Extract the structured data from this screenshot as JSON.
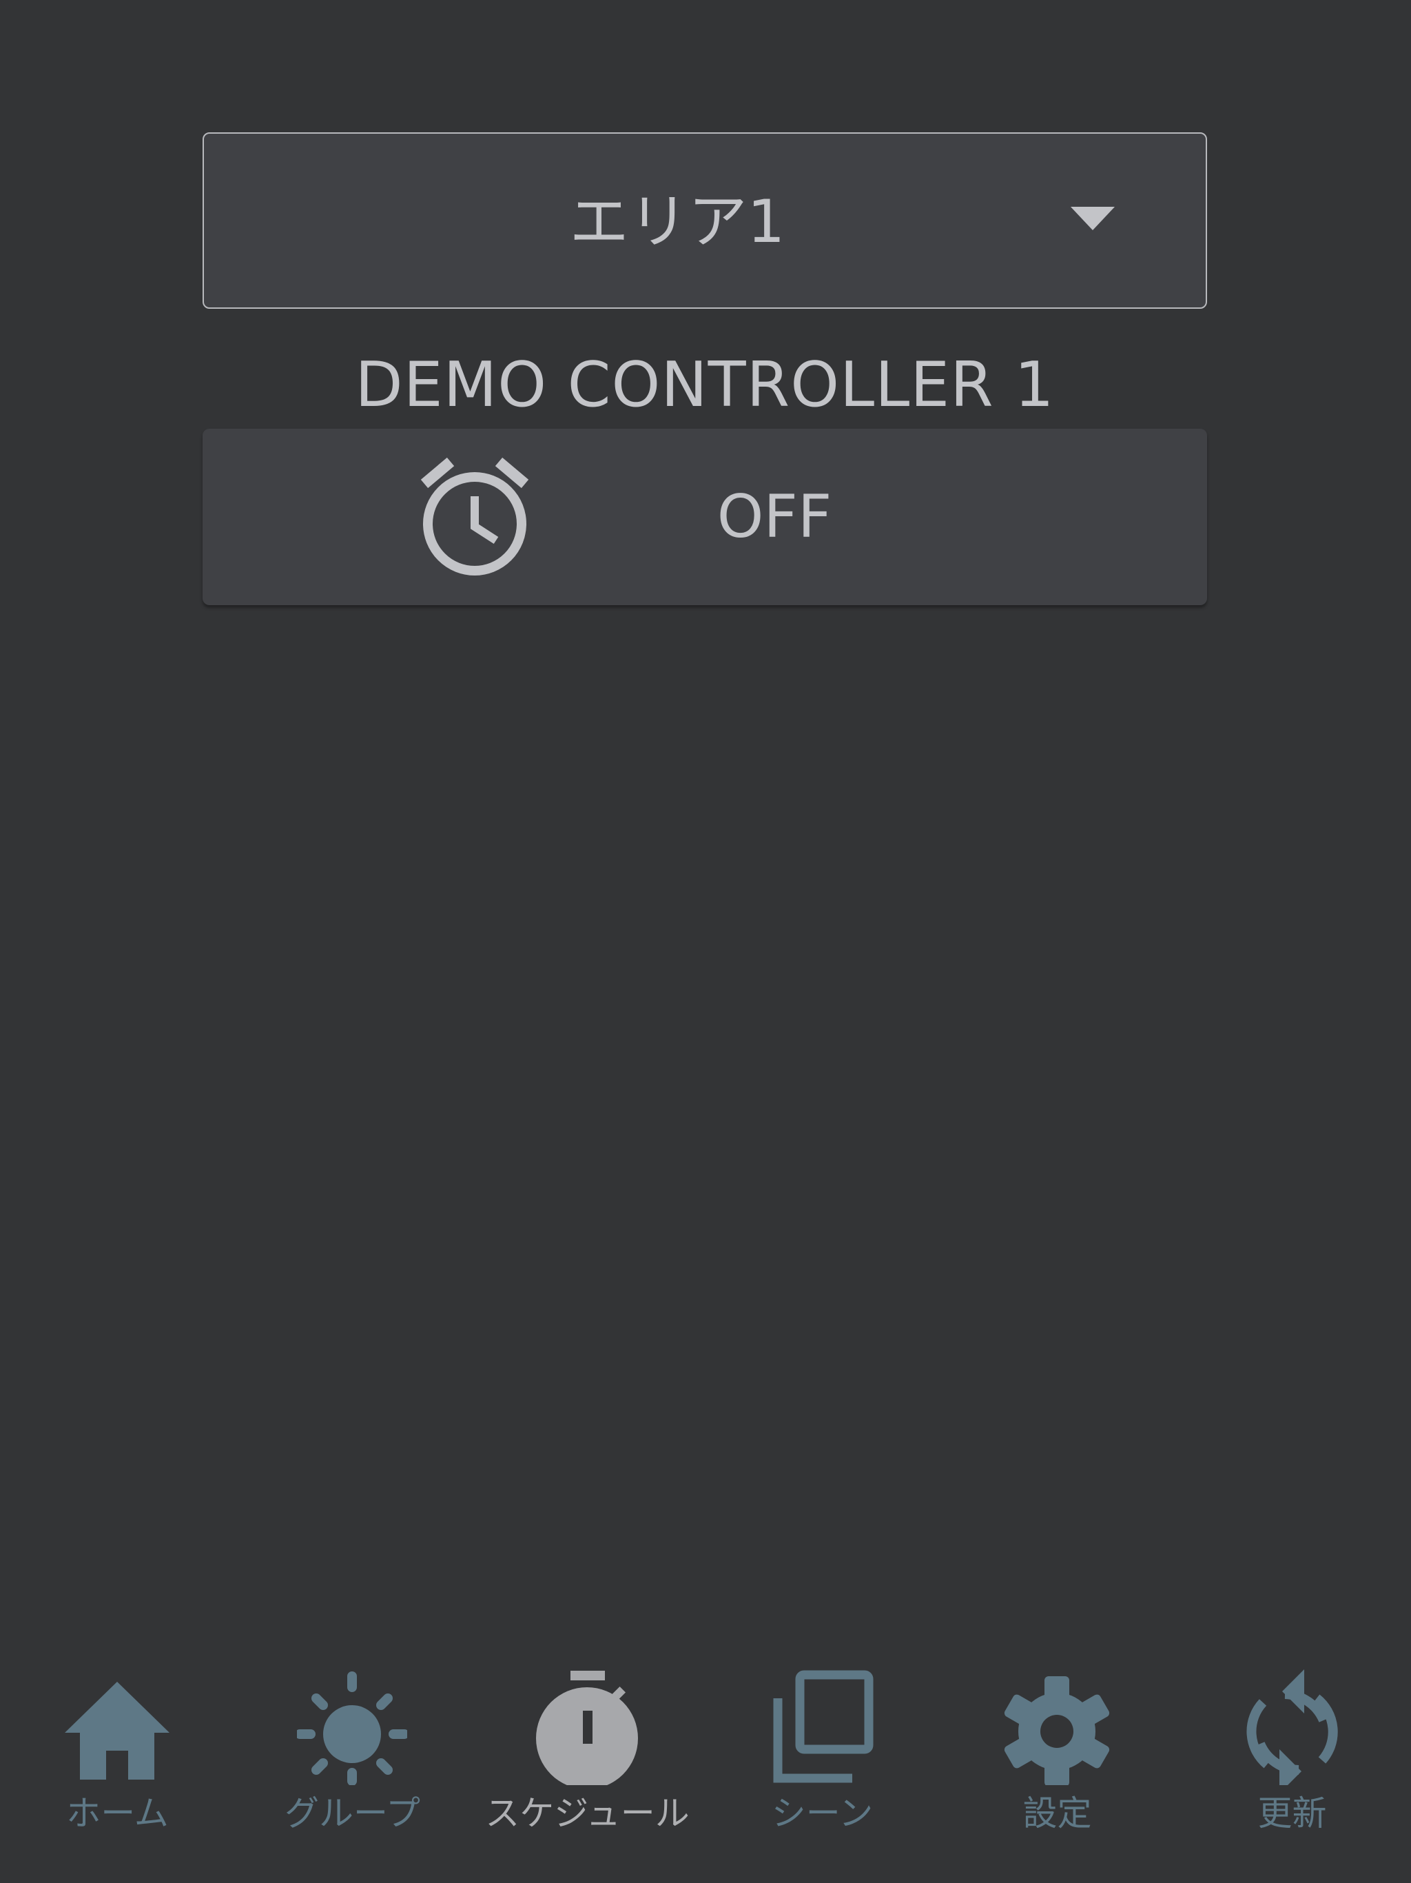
{
  "area_selector": {
    "selected": "エリア1"
  },
  "controller": {
    "name": "DEMO CONTROLLER 1",
    "schedule_status": "OFF"
  },
  "tabbar": {
    "active_tab": "schedule",
    "tabs": [
      {
        "id": "home",
        "label": "ホーム",
        "icon": "home-icon"
      },
      {
        "id": "group",
        "label": "グループ",
        "icon": "sun-icon"
      },
      {
        "id": "schedule",
        "label": "スケジュール",
        "icon": "stopwatch-icon"
      },
      {
        "id": "scene",
        "label": "シーン",
        "icon": "layers-icon"
      },
      {
        "id": "settings",
        "label": "設定",
        "icon": "gear-icon"
      },
      {
        "id": "refresh",
        "label": "更新",
        "icon": "refresh-icon"
      }
    ]
  },
  "colors": {
    "background": "#333436",
    "panel": "#404145",
    "text": "#c3c4c8",
    "tab_inactive": "#5e7886",
    "tab_active": "#aeafb2"
  }
}
